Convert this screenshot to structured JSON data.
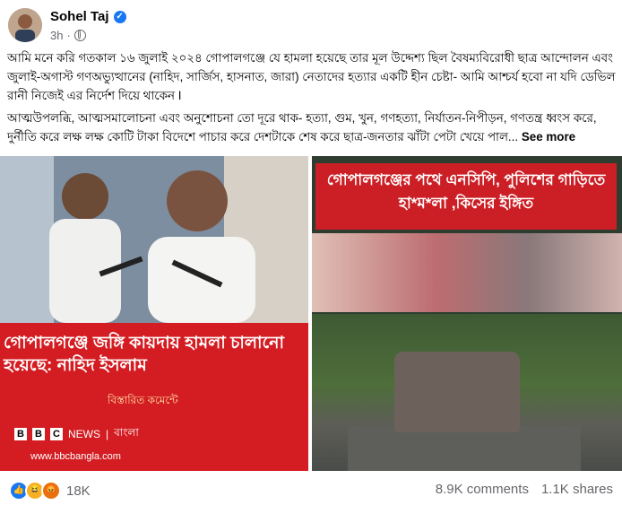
{
  "post": {
    "author": "Sohel Taj",
    "time": "3h",
    "paragraph1": "আমি মনে করি গতকাল ১৬ জুলাই ২০২৪ গোপালগঞ্জে যে হামলা হয়েছে তার মূল উদ্দেশ্য ছিল বৈষম্যবিরোধী ছাত্র আন্দোলন এবং জুলাই-অগাস্ট গণঅভ্যুত্থানের (নাহিদ, সার্জিস, হাসনাত, জারা) নেতাদের হত্যার একটি হীন চেষ্টা- আমি আশ্চর্য হবো না যদি ডেভিল রানী নিজেই এর নির্দেশ দিয়ে থাকেন I",
    "paragraph2": "আত্মউপলব্ধি, আত্মসমালোচনা এবং অনুশোচনা তো দূরে থাক- হত্যা, গুম, খুন, গণহত্যা, নির্যাতন-নিপীড়ন, গণতন্ত্র ধ্বংস করে, দুর্নীতি করে লক্ষ লক্ষ কোটি টাকা বিদেশে পাচার করে দেশটাকে শেষ করে ছাত্র-জনতার ঝাঁটা পেটা খেয়ে পাল...",
    "see_more": "See more"
  },
  "images": {
    "left": {
      "headline": "গোপালগঞ্জে জঙ্গি কায়দায় হামলা চালানো হয়েছে: নাহিদ ইসলাম",
      "sub": "বিস্তারিত কমেন্টে",
      "bbc_news": "NEWS",
      "bbc_lang": "বাংলা",
      "url": "www.bbcbangla.com"
    },
    "right": {
      "headline": "গোপালগঞ্জের পথে এনসিপি, পুলিশের গাড়িতে হা*ম*লা ,কিসের ইঙ্গিত"
    }
  },
  "footer": {
    "reaction_count": "18K",
    "comments": "8.9K comments",
    "shares": "1.1K shares"
  },
  "colors": {
    "accent": "#1877f2",
    "banner_red": "#d41d22",
    "muted_text": "#65676b"
  }
}
